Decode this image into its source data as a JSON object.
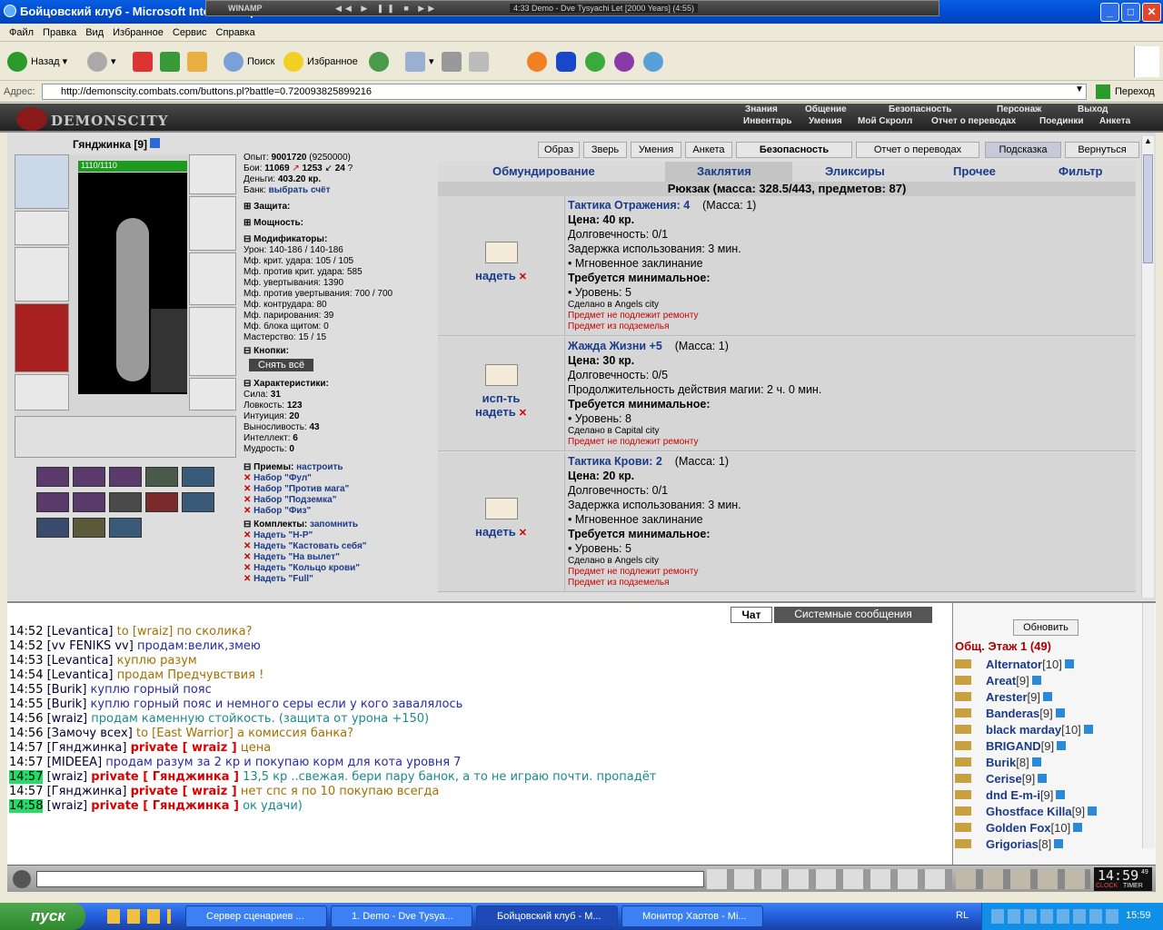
{
  "window": {
    "title": "Бойцовский клуб - Microsoft Internet Explorer"
  },
  "winamp": {
    "label": "WINAMP",
    "track": "4:33 Demo - Dve Tysyachi Let [2000 Years] (4:55)"
  },
  "menu": [
    "Файл",
    "Правка",
    "Вид",
    "Избранное",
    "Сервис",
    "Справка"
  ],
  "toolbar": {
    "back": "Назад",
    "search": "Поиск",
    "favorites": "Избранное"
  },
  "address": {
    "label": "Адрес:",
    "url": "http://demonscity.combats.com/buttons.pl?battle=0.720093825899216",
    "go": "Переход"
  },
  "game_header": {
    "logo": "DEMONSCITY",
    "top_links": [
      "Знания",
      "Общение",
      "Безопасность",
      "Персонаж",
      "Выход"
    ],
    "bottom_links": [
      "Инвентарь",
      "Умения",
      "Мой Скролл",
      "Отчет о переводах",
      "Поединки",
      "Анкета"
    ]
  },
  "character": {
    "name": "Гянджинка",
    "level": "[9]",
    "hp": "1110/1110"
  },
  "stats": {
    "exp_label": "Опыт:",
    "exp": "9001720",
    "exp_next": "(9250000)",
    "fights_label": "Бои:",
    "wins": "11069",
    "losses": "1253",
    "draws": "24",
    "money_label": "Деньги:",
    "money": "403.20 кр.",
    "bank_label": "Банк:",
    "bank": "выбрать счёт",
    "sections": {
      "protection": "Защита:",
      "power": "Мощность:",
      "modifiers": "Модификаторы:",
      "buttons": "Кнопки:",
      "characteristics": "Характеристики:",
      "skills": "Приемы:",
      "sets": "Комплекты:"
    },
    "modifiers": [
      "Урон: 140-186 / 140-186",
      "Мф. крит. удара: 105 / 105",
      "Мф. против крит. удара: 585",
      "Мф. увертывания: 1390",
      "Мф. против увертывания: 700 / 700",
      "Мф. контрудара: 80",
      "Мф. парирования: 39",
      "Мф. блока щитом: 0",
      "Мастерство: 15 / 15"
    ],
    "undress_all": "Снять всё",
    "chars": [
      {
        "k": "Сила:",
        "v": "31"
      },
      {
        "k": "Ловкость:",
        "v": "123"
      },
      {
        "k": "Интуиция:",
        "v": "20"
      },
      {
        "k": "Выносливость:",
        "v": "43"
      },
      {
        "k": "Интеллект:",
        "v": "6"
      },
      {
        "k": "Мудрость:",
        "v": "0"
      }
    ],
    "skills_config": "настроить",
    "skill_sets": [
      "Набор \"Фул\"",
      "Набор \"Против мага\"",
      "Набор \"Подземка\"",
      "Набор \"Физ\""
    ],
    "sets_remember": "запомнить",
    "sets": [
      "Надеть \"Н-Р\"",
      "Надеть \"Кастовать себя\"",
      "Надеть \"На вылет\"",
      "Надеть \"Кольцо крови\"",
      "Надеть \"Full\""
    ]
  },
  "top_tabs": [
    "Образ",
    "Зверь",
    "Умения",
    "Анкета",
    "Безопасность",
    "Отчет о переводах",
    "Подсказка",
    "Вернуться"
  ],
  "categories": [
    "Обмундирование",
    "Заклятия",
    "Эликсиры",
    "Прочее",
    "Фильтр"
  ],
  "backpack": "Рюкзак (масса: 328.5/443, предметов: 87)",
  "items": [
    {
      "name": "Тактика Отражения: 4",
      "mass": "(Масса: 1)",
      "price": "Цена: 40 кр.",
      "lines": [
        "Долговечность: 0/1",
        "Задержка использования: 3 мин.",
        "• Мгновенное заклинание"
      ],
      "req": "Требуется минимальное:",
      "level": "• Уровень: 5",
      "made": "Сделано в Angels city",
      "warn": [
        "Предмет не подлежит ремонту",
        "Предмет из подземелья"
      ],
      "actions": [
        "надеть"
      ]
    },
    {
      "name": "Жажда Жизни +5",
      "mass": "(Масса: 1)",
      "price": "Цена: 30 кр.",
      "lines": [
        "Долговечность: 0/5",
        "Продолжительность действия магии: 2 ч. 0 мин."
      ],
      "req": "Требуется минимальное:",
      "level": "• Уровень: 8",
      "made": "Сделано в Capital city",
      "warn": [
        "Предмет не подлежит ремонту"
      ],
      "actions": [
        "исп-ть",
        "надеть"
      ]
    },
    {
      "name": "Тактика Крови: 2",
      "mass": "(Масса: 1)",
      "price": "Цена: 20 кр.",
      "lines": [
        "Долговечность: 0/1",
        "Задержка использования: 3 мин.",
        "• Мгновенное заклинание"
      ],
      "req": "Требуется минимальное:",
      "level": "• Уровень: 5",
      "made": "Сделано в Angels city",
      "warn": [
        "Предмет не подлежит ремонту",
        "Предмет из подземелья"
      ],
      "actions": [
        "надеть"
      ]
    }
  ],
  "chat_tabs": [
    "Чат",
    "Системные сообщения"
  ],
  "chat": [
    {
      "time": "14:52",
      "nick": "[Levantica]",
      "to": "to [wraiz]",
      "text": "по сколика?",
      "c": "tl"
    },
    {
      "time": "14:52",
      "nick": "[vv FENIKS vv]",
      "to": "",
      "text": "продам:велик,змею",
      "c": "nf"
    },
    {
      "time": "14:53",
      "nick": "[Levantica]",
      "to": "",
      "text": "куплю разум",
      "c": "tl"
    },
    {
      "time": "14:54",
      "nick": "[Levantica]",
      "to": "",
      "text": "продам Предчувствия !",
      "c": "tl"
    },
    {
      "time": "14:55",
      "nick": "[Burik]",
      "to": "",
      "text": "куплю горный пояс",
      "c": "nf"
    },
    {
      "time": "14:55",
      "nick": "[Burik]",
      "to": "",
      "text": "куплю горный пояс и немного серы если у кого завалялось",
      "c": "nf"
    },
    {
      "time": "14:56",
      "nick": "[wraiz]",
      "to": "",
      "text": "продам каменную стойкость. (защита от урона +150)",
      "c": "tl2"
    },
    {
      "time": "14:56",
      "nick": "[Замочу всех]",
      "to": "to [East Warrior]",
      "text": "а комиссия банка?",
      "c": "tl"
    },
    {
      "time": "14:57",
      "nick": "[Гянджинка]",
      "to": "private [ wraiz ]",
      "text": "цена",
      "c": "tl"
    },
    {
      "time": "14:57",
      "nick": "[MIDEEA]",
      "to": "",
      "text": "продам разум за 2 кр и покупаю корм для кота уровня 7",
      "c": "nf"
    },
    {
      "time": "14:57",
      "nick": "[wraiz]",
      "to": "private [ Гянджинка ]",
      "text": "13,5 кр ..свежая. бери пару банок, а то не играю почти. пропадёт",
      "c": "tl2",
      "hl": true
    },
    {
      "time": "14:57",
      "nick": "[Гянджинка]",
      "to": "private [ wraiz ]",
      "text": "нет спс я по 10 покупаю всегда",
      "c": "tl"
    },
    {
      "time": "14:58",
      "nick": "[wraiz]",
      "to": "private [ Гянджинка ]",
      "text": "ок удачи)",
      "c": "tl2",
      "hl": true
    }
  ],
  "online": {
    "refresh": "Обновить",
    "room": "Общ. Этаж 1 (49)",
    "users": [
      {
        "n": "Alternator",
        "l": "[10]"
      },
      {
        "n": "Areat",
        "l": "[9]"
      },
      {
        "n": "Arester",
        "l": "[9]"
      },
      {
        "n": "Banderas",
        "l": "[9]"
      },
      {
        "n": "black marday",
        "l": "[10]"
      },
      {
        "n": "BRIGAND",
        "l": "[9]"
      },
      {
        "n": "Burik",
        "l": "[8]"
      },
      {
        "n": "Cerise",
        "l": "[9]"
      },
      {
        "n": "dnd E-m-i",
        "l": "[9]"
      },
      {
        "n": "Ghostface Killa",
        "l": "[9]"
      },
      {
        "n": "Golden Fox",
        "l": "[10]"
      },
      {
        "n": "Grigorias",
        "l": "[8]"
      }
    ]
  },
  "clock": {
    "time": "14:59",
    "sec": "49",
    "label": "CLOCK",
    "timer": "TIMER"
  },
  "taskbar": {
    "start": "пуск",
    "tasks": [
      "Сервер сценариев ...",
      "1. Demo - Dve Tysya...",
      "Бойцовский клуб - M...",
      "Монитор Хаотов - Mi..."
    ],
    "lang": "RL",
    "time": "15:59"
  },
  "colors": {
    "title_blue": "#0050d8",
    "link_blue": "#1a3a8a",
    "private_red": "#d00",
    "hp_green": "#1e9a1e"
  }
}
